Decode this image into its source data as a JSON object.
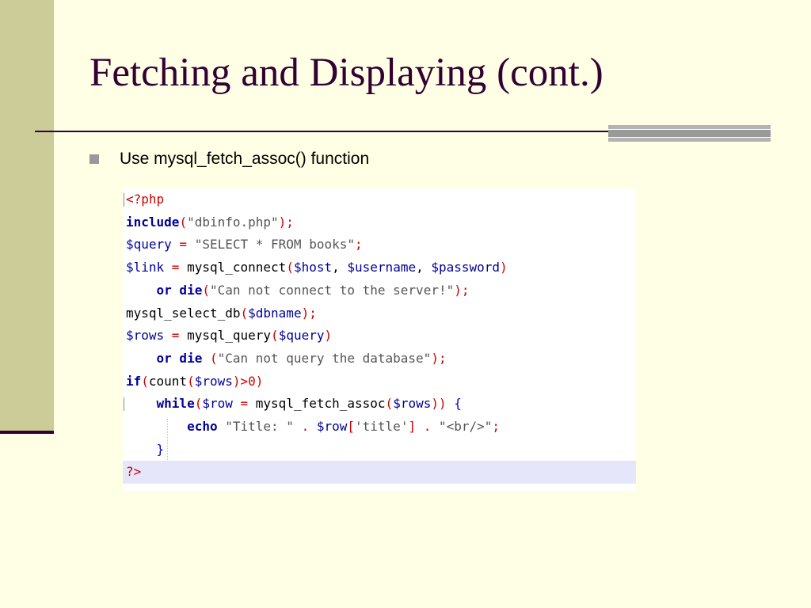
{
  "slide": {
    "title": "Fetching and Displaying (cont.)",
    "bullet": "Use mysql_fetch_assoc() function"
  },
  "code": {
    "lines": [
      [
        {
          "t": "<?php",
          "c": "php"
        }
      ],
      [
        {
          "t": "include",
          "c": "kw"
        },
        {
          "t": "(",
          "c": "op"
        },
        {
          "t": "\"dbinfo.php\"",
          "c": "str"
        },
        {
          "t": ");",
          "c": "op"
        }
      ],
      [
        {
          "t": "$query",
          "c": "var"
        },
        {
          "t": " = ",
          "c": "op"
        },
        {
          "t": "\"SELECT * FROM books\"",
          "c": "str"
        },
        {
          "t": ";",
          "c": "op"
        }
      ],
      [
        {
          "t": "$link",
          "c": "var"
        },
        {
          "t": " = ",
          "c": "op"
        },
        {
          "t": "mysql_connect",
          "c": "plain"
        },
        {
          "t": "(",
          "c": "op"
        },
        {
          "t": "$host",
          "c": "var"
        },
        {
          "t": ", ",
          "c": "plain"
        },
        {
          "t": "$username",
          "c": "var"
        },
        {
          "t": ", ",
          "c": "plain"
        },
        {
          "t": "$password",
          "c": "var"
        },
        {
          "t": ")",
          "c": "op"
        }
      ],
      [
        {
          "t": "    ",
          "c": "plain"
        },
        {
          "t": "or die",
          "c": "kw"
        },
        {
          "t": "(",
          "c": "op"
        },
        {
          "t": "\"Can not connect to the server!\"",
          "c": "str"
        },
        {
          "t": ");",
          "c": "op"
        }
      ],
      [
        {
          "t": "mysql_select_db",
          "c": "plain"
        },
        {
          "t": "(",
          "c": "op"
        },
        {
          "t": "$dbname",
          "c": "var"
        },
        {
          "t": ");",
          "c": "op"
        }
      ],
      [
        {
          "t": "$rows",
          "c": "var"
        },
        {
          "t": " = ",
          "c": "op"
        },
        {
          "t": "mysql_query",
          "c": "plain"
        },
        {
          "t": "(",
          "c": "op"
        },
        {
          "t": "$query",
          "c": "var"
        },
        {
          "t": ")",
          "c": "op"
        }
      ],
      [
        {
          "t": "    ",
          "c": "plain"
        },
        {
          "t": "or die",
          "c": "kw"
        },
        {
          "t": " (",
          "c": "op"
        },
        {
          "t": "\"Can not query the database\"",
          "c": "str"
        },
        {
          "t": ");",
          "c": "op"
        }
      ],
      [
        {
          "t": "if",
          "c": "kw"
        },
        {
          "t": "(",
          "c": "op"
        },
        {
          "t": "count",
          "c": "plain"
        },
        {
          "t": "(",
          "c": "op"
        },
        {
          "t": "$rows",
          "c": "var"
        },
        {
          "t": ")>",
          "c": "op"
        },
        {
          "t": "0",
          "c": "num"
        },
        {
          "t": ")",
          "c": "op"
        }
      ],
      [
        {
          "t": "    ",
          "c": "plain"
        },
        {
          "t": "while",
          "c": "kw"
        },
        {
          "t": "(",
          "c": "op"
        },
        {
          "t": "$row",
          "c": "var"
        },
        {
          "t": " = ",
          "c": "op"
        },
        {
          "t": "mysql_fetch_assoc",
          "c": "plain"
        },
        {
          "t": "(",
          "c": "op"
        },
        {
          "t": "$rows",
          "c": "var"
        },
        {
          "t": ")) ",
          "c": "op"
        },
        {
          "t": "{",
          "c": "brace"
        }
      ],
      [
        {
          "t": "        ",
          "c": "plain"
        },
        {
          "t": "echo",
          "c": "kw"
        },
        {
          "t": " ",
          "c": "plain"
        },
        {
          "t": "\"Title: \"",
          "c": "str"
        },
        {
          "t": " . ",
          "c": "op"
        },
        {
          "t": "$row",
          "c": "var"
        },
        {
          "t": "[",
          "c": "op"
        },
        {
          "t": "'title'",
          "c": "str"
        },
        {
          "t": "] . ",
          "c": "op"
        },
        {
          "t": "\"<br/>\"",
          "c": "str"
        },
        {
          "t": ";",
          "c": "op"
        }
      ],
      [
        {
          "t": "    ",
          "c": "plain"
        },
        {
          "t": "}",
          "c": "brace"
        }
      ],
      [
        {
          "t": "?>",
          "c": "php"
        }
      ]
    ],
    "highlight_line": 12,
    "gutter_marker_lines": [
      0,
      9
    ]
  },
  "colors": {
    "background": "#FFFFE5",
    "left_bar": "#CCCC99",
    "title_text": "#330033",
    "rule": "#330033",
    "rule_accent": "#999999",
    "bullet": "#999999",
    "code_background": "#FFFFFF",
    "code_highlight": "#E6E6FA"
  },
  "icons": {
    "bullet": "square-bullet-icon"
  }
}
